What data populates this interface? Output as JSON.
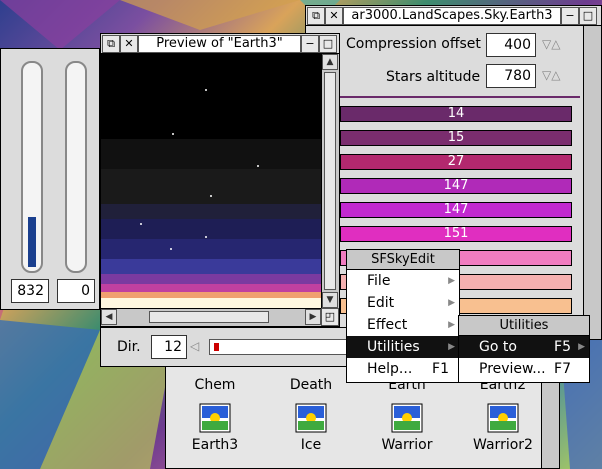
{
  "colors": {
    "window_bg": "#dcdcdc",
    "selected_bg": "#111111",
    "bar_colors": [
      "#6a2a6a",
      "#7a2d6e",
      "#b2286e",
      "#b02ab8",
      "#c22ad0",
      "#e02ec0"
    ]
  },
  "left_panel": {
    "value_left": "832",
    "value_right": "0",
    "meter_left_fraction": 0.25,
    "meter_right_fraction": 0.0
  },
  "preview_window": {
    "title": "Preview of \"Earth3\"",
    "direction_label": "Dir.",
    "direction_value": "12"
  },
  "main_window": {
    "title": "ar3000.LandScapes.Sky.Earth3",
    "compression_label": "Compression offset",
    "compression_value": "400",
    "stars_label": "Stars altitude",
    "stars_value": "780",
    "bars": [
      "14",
      "15",
      "27",
      "147",
      "147",
      "151"
    ]
  },
  "menu": {
    "title": "SFSkyEdit",
    "items": [
      {
        "label": "File",
        "shortcut": ""
      },
      {
        "label": "Edit",
        "shortcut": ""
      },
      {
        "label": "Effect",
        "shortcut": ""
      },
      {
        "label": "Utilities",
        "shortcut": ""
      },
      {
        "label": "Help...",
        "shortcut": "F1"
      }
    ]
  },
  "submenu": {
    "title": "Utilities",
    "items": [
      {
        "label": "Go to",
        "shortcut": "F5"
      },
      {
        "label": "Preview...",
        "shortcut": "F7"
      }
    ]
  },
  "filer": {
    "row1": [
      "Chem",
      "Death",
      "Earth",
      "Earth2"
    ],
    "row2": [
      "Earth3",
      "Ice",
      "Warrior",
      "Warrior2"
    ]
  },
  "icons": {
    "close": "close-icon",
    "back": "back-icon",
    "toggle": "toggle-size-icon",
    "iconise": "iconise-icon"
  }
}
